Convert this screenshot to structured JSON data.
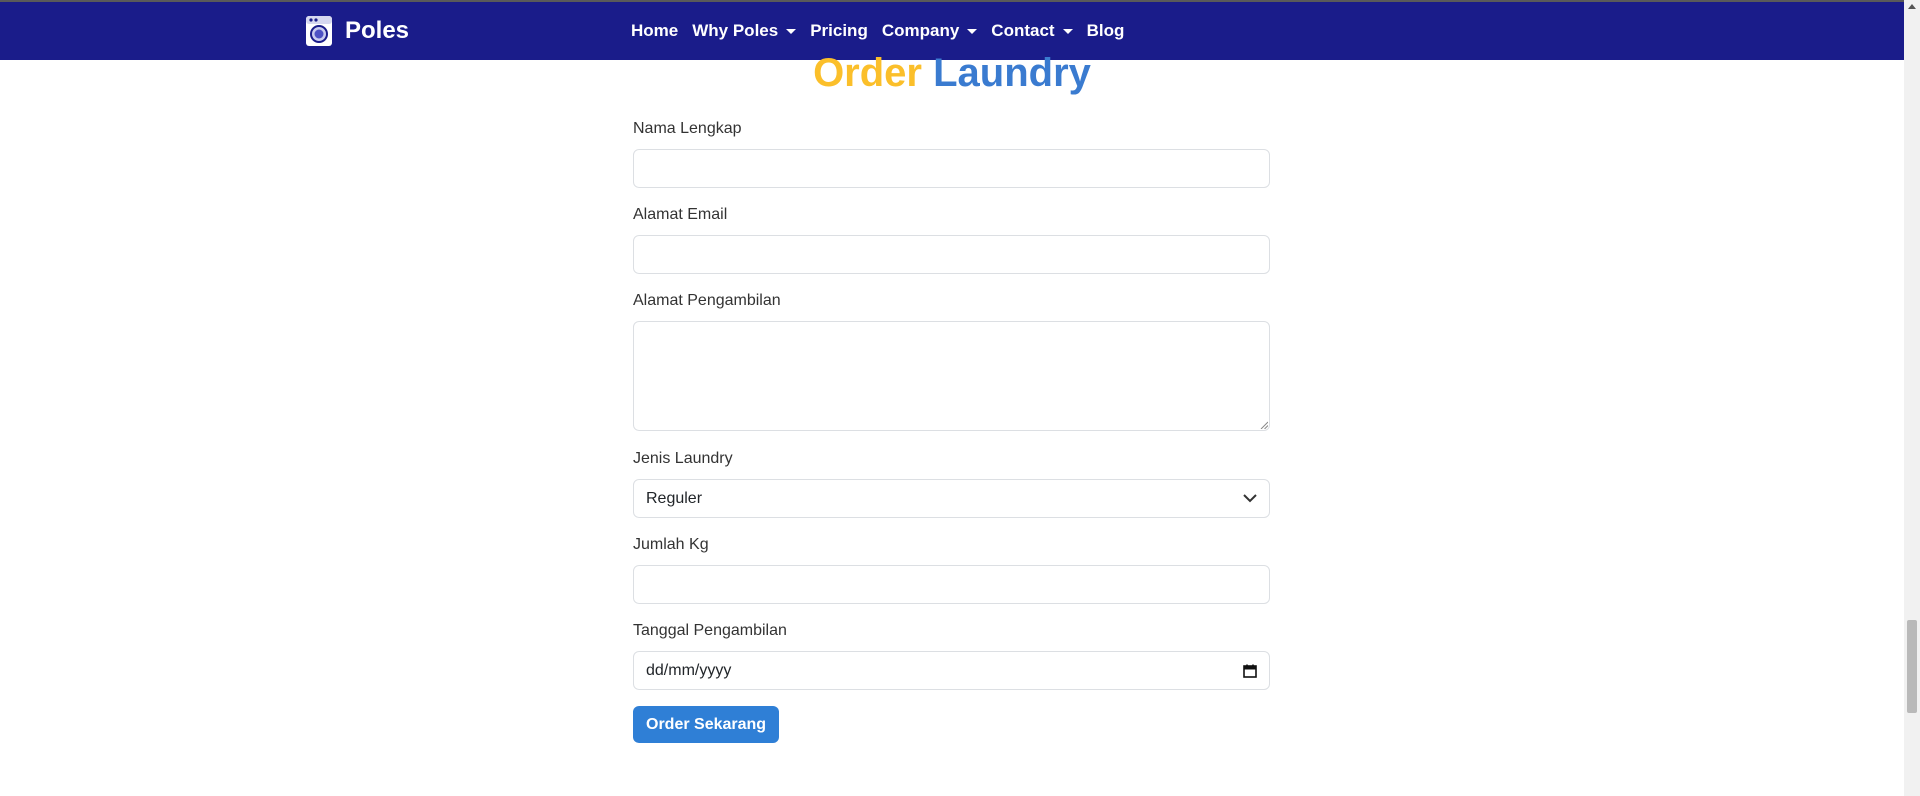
{
  "navbar": {
    "brand": "Poles",
    "logo_icon": "washing-machine-icon",
    "items": [
      {
        "label": "Home",
        "dropdown": false
      },
      {
        "label": "Why Poles",
        "dropdown": true
      },
      {
        "label": "Pricing",
        "dropdown": false
      },
      {
        "label": "Company",
        "dropdown": true
      },
      {
        "label": "Contact",
        "dropdown": true
      },
      {
        "label": "Blog",
        "dropdown": false
      }
    ],
    "background": "#1a1c8a"
  },
  "heading": {
    "word1": "Order",
    "word2": "Laundry",
    "color1": "#fbbf2a",
    "color2": "#3a7bd0"
  },
  "form": {
    "name_label": "Nama Lengkap",
    "name_value": "",
    "email_label": "Alamat Email",
    "email_value": "",
    "address_label": "Alamat Pengambilan",
    "address_value": "",
    "type_label": "Jenis Laundry",
    "type_selected": "Reguler",
    "weight_label": "Jumlah Kg",
    "weight_value": "",
    "date_label": "Tanggal Pengambilan",
    "date_placeholder": "dd/mm/yyyy",
    "submit_label": "Order Sekarang",
    "button_color": "#2f7fd6"
  }
}
